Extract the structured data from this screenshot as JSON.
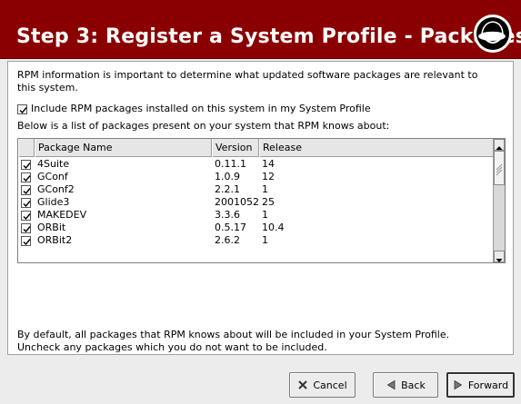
{
  "header": {
    "title": "Step 3: Register a System Profile - Packages",
    "logo_icon": "redhat-shadowman-logo-icon",
    "background_color": "#8a0000"
  },
  "intro": {
    "text": "RPM information is important to determine what updated software packages are relevant to this system."
  },
  "include_option": {
    "checked": true,
    "label": "Include RPM packages installed on this system in my System Profile"
  },
  "list_label": "Below is a list of packages present on your system that RPM knows about:",
  "table": {
    "columns": [
      "",
      "Package Name",
      "Version",
      "Release"
    ],
    "rows": [
      {
        "checked": true,
        "name": "4Suite",
        "version": "0.11.1",
        "release": "14"
      },
      {
        "checked": true,
        "name": "GConf",
        "version": "1.0.9",
        "release": "12"
      },
      {
        "checked": true,
        "name": "GConf2",
        "version": "2.2.1",
        "release": "1"
      },
      {
        "checked": true,
        "name": "Glide3",
        "version": "2001052",
        "release": "25"
      },
      {
        "checked": true,
        "name": "MAKEDEV",
        "version": "3.3.6",
        "release": "1"
      },
      {
        "checked": true,
        "name": "ORBit",
        "version": "0.5.17",
        "release": "10.4"
      },
      {
        "checked": true,
        "name": "ORBit2",
        "version": "2.6.2",
        "release": "1"
      }
    ]
  },
  "footer_note": {
    "line1": "By default, all packages that RPM knows about will be included in your System Profile.",
    "line2": "Uncheck any packages which you do not want to be included."
  },
  "buttons": {
    "cancel": {
      "label": "Cancel",
      "icon": "close-x-icon"
    },
    "back": {
      "label": "Back",
      "icon": "back-arrow-icon"
    },
    "forward": {
      "label": "Forward",
      "icon": "forward-arrow-icon"
    }
  }
}
